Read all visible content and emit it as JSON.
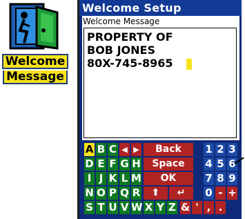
{
  "app_icon": {
    "name": "door-exit-icon",
    "label_line1": "Welcome",
    "label_line2": "Message"
  },
  "screen": {
    "title": "Welcome Setup",
    "field_label": "Welcome Message",
    "message_lines": [
      "PROPERTY OF",
      "BOB JONES",
      "80X-745-8965"
    ]
  },
  "keyboard": {
    "rows": [
      [
        "A",
        "B",
        "C",
        "◀",
        "▶",
        "Back",
        "1",
        "2",
        "3"
      ],
      [
        "D",
        "E",
        "F",
        "G",
        "H",
        "Space",
        "4",
        "5",
        "6"
      ],
      [
        "I",
        "J",
        "K",
        "L",
        "M",
        "OK",
        "7",
        "8",
        "9"
      ],
      [
        "N",
        "O",
        "P",
        "Q",
        "R",
        "⬆",
        "↵",
        "0",
        "-",
        "+"
      ],
      [
        "S",
        "T",
        "U",
        "V",
        "W",
        "X",
        "Y",
        "Z",
        "&",
        "'",
        ",",
        "."
      ]
    ],
    "selected_key": "A"
  },
  "colors": {
    "screen_bg": "#0e2a78",
    "title_bg": "#123a95",
    "letter_key": "#0f7a22",
    "function_key": "#b22323",
    "digit_key": "#1d4aa8",
    "highlight": "#f7e21b"
  }
}
